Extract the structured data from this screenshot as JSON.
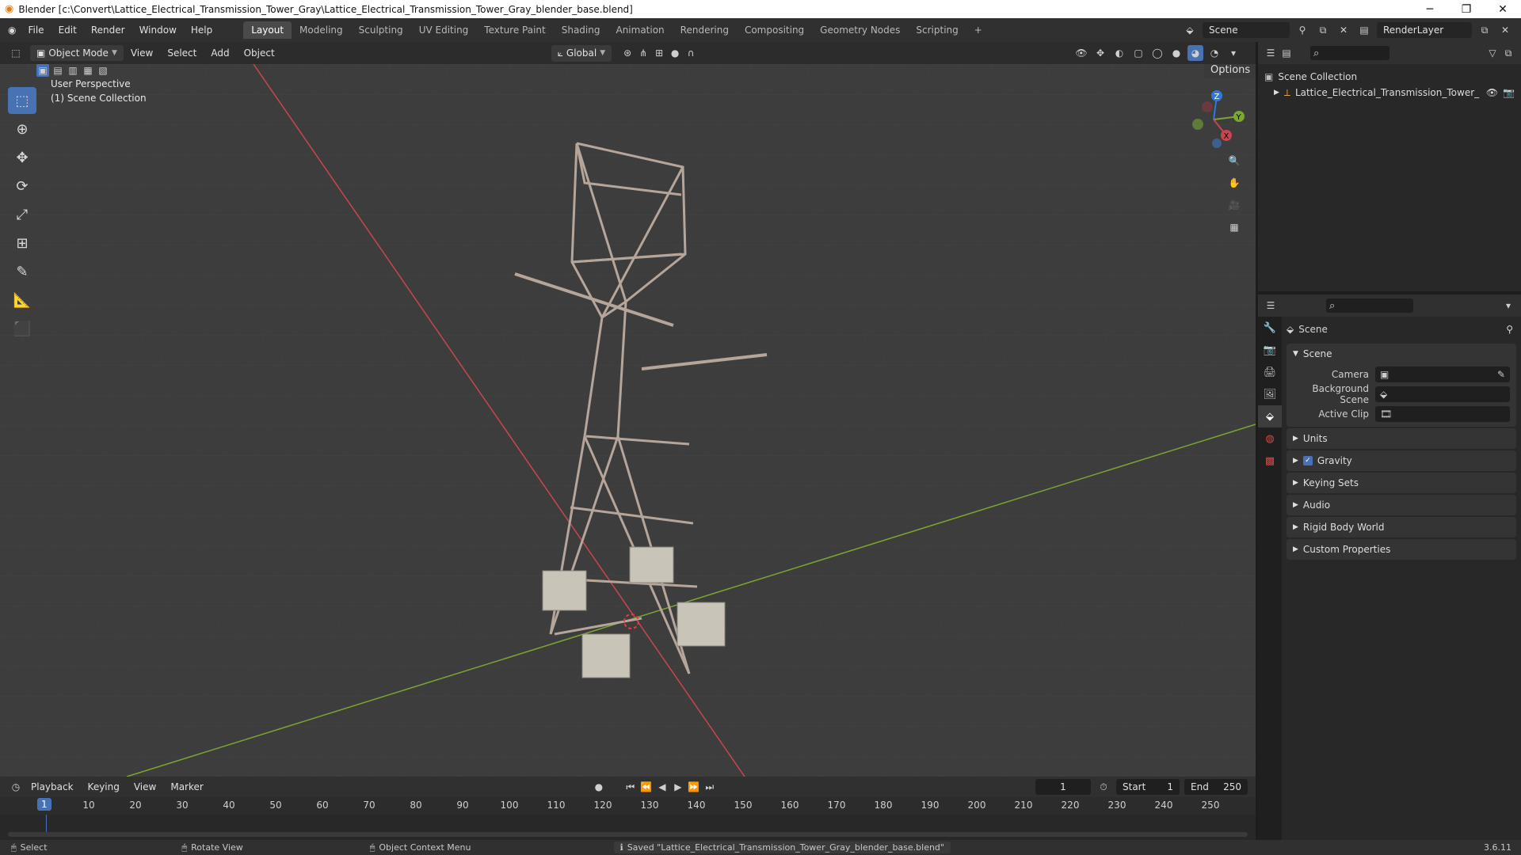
{
  "window": {
    "title": "Blender [c:\\Convert\\Lattice_Electrical_Transmission_Tower_Gray\\Lattice_Electrical_Transmission_Tower_Gray_blender_base.blend]",
    "minimize": "─",
    "maximize": "❐",
    "close": "✕"
  },
  "menu": [
    "File",
    "Edit",
    "Render",
    "Window",
    "Help"
  ],
  "workspaces": [
    "Layout",
    "Modeling",
    "Sculpting",
    "UV Editing",
    "Texture Paint",
    "Shading",
    "Animation",
    "Rendering",
    "Compositing",
    "Geometry Nodes",
    "Scripting"
  ],
  "workspace_add": "+",
  "scene_selector": "Scene",
  "renderlayer_selector": "RenderLayer",
  "viewport_header": {
    "mode": "Object Mode",
    "menus": [
      "View",
      "Select",
      "Add",
      "Object"
    ],
    "orientation": "Global",
    "options": "Options"
  },
  "viewport": {
    "perspective_label": "User Perspective",
    "collection_label": "(1) Scene Collection",
    "gizmo": {
      "x": "X",
      "y": "Y",
      "z": "Z"
    }
  },
  "outliner": {
    "root": "Scene Collection",
    "object": "Lattice_Electrical_Transmission_Tower_"
  },
  "properties": {
    "context_title": "Scene",
    "scene_panel": "Scene",
    "fields": [
      {
        "label": "Camera",
        "value": ""
      },
      {
        "label": "Background Scene",
        "value": ""
      },
      {
        "label": "Active Clip",
        "value": ""
      }
    ],
    "collapsed_panels": [
      "Units",
      "Gravity",
      "Keying Sets",
      "Audio",
      "Rigid Body World",
      "Custom Properties"
    ]
  },
  "timeline": {
    "menus": [
      "Playback",
      "Keying",
      "View",
      "Marker"
    ],
    "current_frame": "1",
    "start_label": "Start",
    "start": "1",
    "end_label": "End",
    "end": "250",
    "ticks": [
      "10",
      "20",
      "30",
      "40",
      "50",
      "60",
      "70",
      "80",
      "90",
      "100",
      "110",
      "120",
      "130",
      "140",
      "150",
      "160",
      "170",
      "180",
      "190",
      "200",
      "210",
      "220",
      "230",
      "240",
      "250"
    ],
    "playhead": "1"
  },
  "statusbar": {
    "select": "Select",
    "rotate": "Rotate View",
    "context_menu": "Object Context Menu",
    "message": "Saved \"Lattice_Electrical_Transmission_Tower_Gray_blender_base.blend\"",
    "version": "3.6.11"
  },
  "colors": {
    "accent": "#4772b3",
    "x_axis": "#c8464e",
    "y_axis": "#7aa631",
    "z_axis": "#2f79d8",
    "tower": "#b5a59a",
    "footing": "#c9c4b8"
  }
}
